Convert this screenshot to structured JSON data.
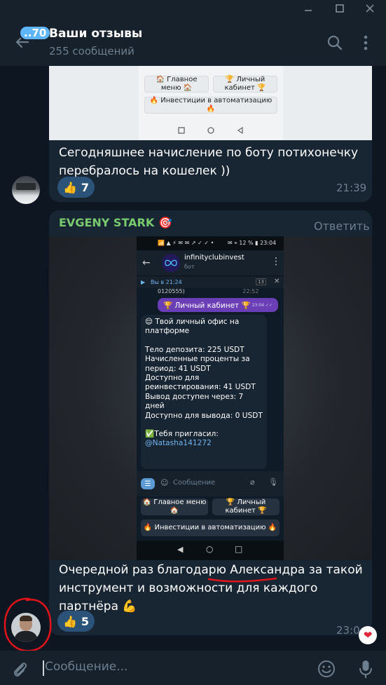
{
  "window": {
    "controls": [
      "minimize-icon",
      "maximize-icon",
      "close-icon"
    ]
  },
  "header": {
    "unread_count": "..70",
    "title": "Ваши отзывы",
    "subtitle": "255 сообщений",
    "icons": [
      "back-arrow-icon",
      "search-icon",
      "more-vertical-icon"
    ]
  },
  "message1": {
    "screenshot": {
      "btn_main": "🏠 Главное меню 🏠",
      "btn_cabinet": "🏆 Личный кабинет 🏆",
      "btn_invest": "🔥 Инвестиции в автоматизацию 🔥"
    },
    "text": "Сегодняшнее начисление по боту потихонечку перебралось на кошелек ))",
    "reaction_emoji": "👍",
    "reaction_count": "7",
    "time": "21:39"
  },
  "message2": {
    "sender": "EVGENY STARK",
    "sender_badge": "🎯",
    "reply_label": "Ответить",
    "screenshot": {
      "status_left": "📶 ▲ ⚡ ✉ ✉ ↗ ✓ ✓ •",
      "status_right": "✉ ⌖ 12 % ▮ 23:04",
      "bot_name": "infinityclubinvest",
      "bot_label": "бот",
      "pinned": "Вы в 21:24",
      "pinned_count": "13",
      "prev_time": "22:52",
      "prev_text": "0120555)",
      "out_text": "🏆 Личный кабинет 🏆",
      "out_time": "23:04 ✓✓",
      "office_title": "😌 Твой личный офис на платформе",
      "lines": [
        "Тело депозита: 225 USDT",
        "Начисленные проценты за период: 41 USDT",
        "Доступно для реинвестирования: 41 USDT",
        "Вывод доступен через: 7 дней",
        "Доступно для вывода: 0 USDT"
      ],
      "invited_label": "✅Тебя пригласил:",
      "invited_user": "@Natasha141272",
      "input_placeholder": "Сообщение",
      "btn_main": "🏠 Главное меню 🏠",
      "btn_cabinet": "🏆 Личный кабинет 🏆",
      "btn_invest": "🔥 Инвестиции в автоматизацию 🔥"
    },
    "text_line1": "Очередной раз благодарю Александра за такой",
    "text_line2": "инструмент и возможности для каждого партнёра 💪",
    "text_line3": "💪💪",
    "reaction_emoji": "👍",
    "reaction_count": "5",
    "time": "23:0",
    "corner_reaction": "❤"
  },
  "compose": {
    "placeholder": "Сообщение...",
    "icons": [
      "attach-icon",
      "emoji-icon",
      "microphone-icon"
    ]
  },
  "colors": {
    "accent": "#5eb5f7",
    "bubble": "#182533",
    "background": "#0e1621",
    "panel": "#17212b",
    "sender": "#79c96f",
    "annotation": "#e0141a"
  }
}
